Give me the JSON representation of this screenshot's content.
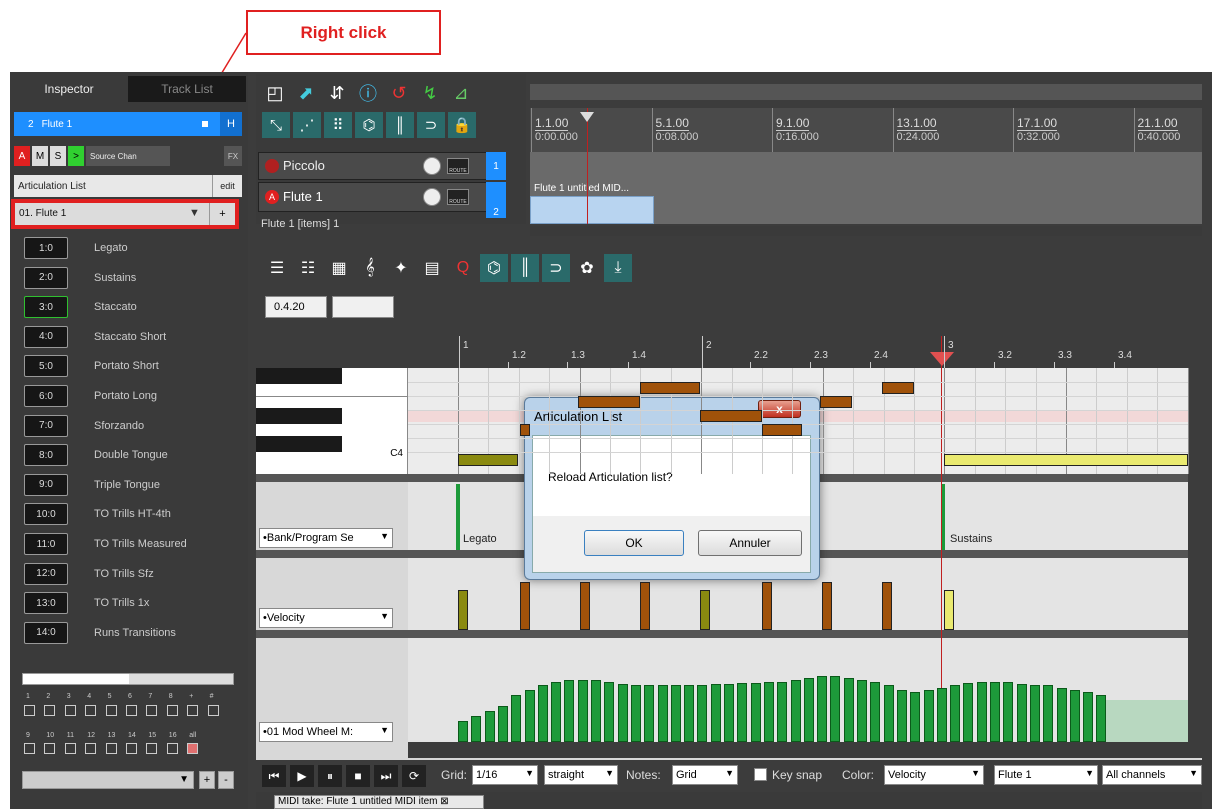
{
  "callout": {
    "label": "Right click"
  },
  "inspector": {
    "tabs": [
      "Inspector",
      "Track List"
    ],
    "track": {
      "number": "2",
      "name": "Flute 1",
      "h_label": "H"
    },
    "buttons": {
      "arm": "A",
      "mute": "M",
      "solo": "S",
      "play": ">",
      "source": "Source Chan",
      "fx": "FX"
    },
    "articulation_header": "Articulation List",
    "edit_label": "edit",
    "selected_list": "01. Flute 1",
    "add_label": "+",
    "articulations": [
      {
        "badge": "1:0",
        "label": "Legato"
      },
      {
        "badge": "2:0",
        "label": "Sustains"
      },
      {
        "badge": "3:0",
        "label": "Staccato"
      },
      {
        "badge": "4:0",
        "label": "Staccato Short"
      },
      {
        "badge": "5:0",
        "label": "Portato Short"
      },
      {
        "badge": "6:0",
        "label": "Portato Long"
      },
      {
        "badge": "7:0",
        "label": "Sforzando"
      },
      {
        "badge": "8:0",
        "label": "Double Tongue"
      },
      {
        "badge": "9:0",
        "label": "Triple Tongue"
      },
      {
        "badge": "10:0",
        "label": "TO Trills HT-4th"
      },
      {
        "badge": "11:0",
        "label": "TO Trills Measured"
      },
      {
        "badge": "12:0",
        "label": "TO Trills Sfz"
      },
      {
        "badge": "13:0",
        "label": "TO Trills 1x"
      },
      {
        "badge": "14:0",
        "label": "Runs Transitions"
      }
    ],
    "channels_row1": [
      "1",
      "2",
      "3",
      "4",
      "5",
      "6",
      "7",
      "8",
      "+",
      "#"
    ],
    "channels_row2": [
      "9",
      "10",
      "11",
      "12",
      "13",
      "14",
      "15",
      "16",
      "all"
    ],
    "bottom_plus": "+",
    "bottom_minus": "-"
  },
  "arrange": {
    "ruler_bars": [
      "1.1.00",
      "5.1.00",
      "9.1.00",
      "13.1.00",
      "17.1.00",
      "21.1.00"
    ],
    "ruler_times": [
      "0:00.000",
      "0:08.000",
      "0:16.000",
      "0:24.000",
      "0:32.000",
      "0:40.000"
    ],
    "tracks": [
      {
        "name": "Piccolo",
        "number": "1"
      },
      {
        "name": "Flute 1",
        "number": "2"
      }
    ],
    "route_label": "ROUTE",
    "item_label": "Flute 1 untitled MID...",
    "status": "Flute 1 [items] 1"
  },
  "midi": {
    "position": "0.4.20",
    "ruler_marks": [
      "1",
      "1.2",
      "1.3",
      "1.4",
      "2",
      "2.2",
      "2.3",
      "2.4",
      "3",
      "3.2",
      "3.3",
      "3.4"
    ],
    "c4_label": "C4",
    "lanes": [
      {
        "select": "•Bank/Program Se",
        "left_text": "Legato",
        "right_text": "Sustains"
      },
      {
        "select": "•Velocity"
      },
      {
        "select": "•01 Mod Wheel M:"
      }
    ],
    "mod_values": [
      0.2,
      0.25,
      0.3,
      0.35,
      0.45,
      0.5,
      0.55,
      0.58,
      0.6,
      0.6,
      0.6,
      0.58,
      0.56,
      0.55,
      0.55,
      0.55,
      0.55,
      0.55,
      0.55,
      0.56,
      0.56,
      0.57,
      0.57,
      0.58,
      0.58,
      0.6,
      0.62,
      0.63,
      0.63,
      0.62,
      0.6,
      0.58,
      0.55,
      0.5,
      0.48,
      0.5,
      0.52,
      0.55,
      0.57,
      0.58,
      0.58,
      0.58,
      0.56,
      0.55,
      0.55,
      0.52,
      0.5,
      0.48,
      0.45
    ],
    "transport": {
      "grid_label": "Grid:",
      "grid_value": "1/16",
      "straight": "straight",
      "notes_label": "Notes:",
      "notes_value": "Grid",
      "key_snap": "Key snap",
      "color_label": "Color:",
      "color_value": "Velocity",
      "track_value": "Flute 1",
      "channels_value": "All channels"
    },
    "take_tab": "MIDI take: Flute 1 untitled MIDI item"
  },
  "dialog": {
    "title": "Articulation List",
    "message": "Reload Articulation list?",
    "ok": "OK",
    "cancel": "Annuler",
    "close": "x"
  },
  "colors": {
    "accent_blue": "#1e8fff",
    "highlight_red": "#e02020",
    "mod_green": "#1d9a3a",
    "note_brown": "#a0520a",
    "note_olive": "#8a8a10"
  }
}
